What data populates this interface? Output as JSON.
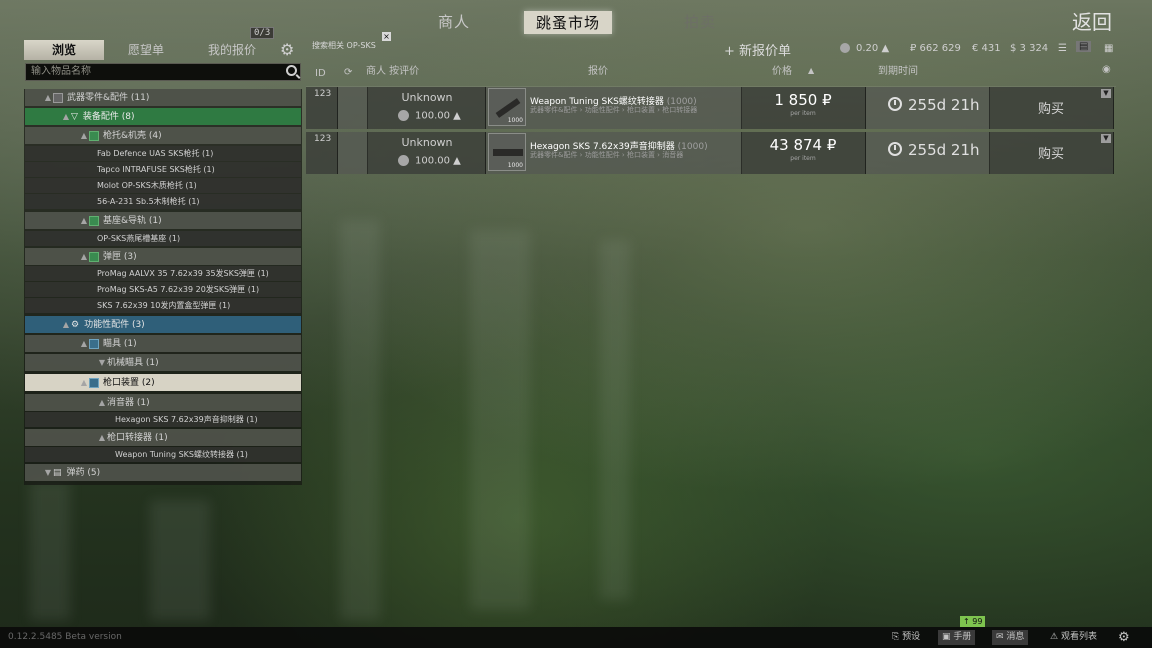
{
  "nav": {
    "traders": "商人",
    "flea_market": "跳蚤市场",
    "auction": "拍卖",
    "back": "返回"
  },
  "left_tabs": {
    "browse": "浏览",
    "wishlist": "愿望单",
    "my_offers": "我的报价",
    "offer_count": "0/3"
  },
  "search": {
    "placeholder": "输入物品名称"
  },
  "tree": [
    {
      "label": "武器零件&配件 (11)"
    },
    {
      "label": "装备配件 (8)"
    },
    {
      "label": "枪托&机壳 (4)"
    },
    {
      "label": "Fab Defence UAS SKS枪托 (1)"
    },
    {
      "label": "Tapco INTRAFUSE SKS枪托 (1)"
    },
    {
      "label": "Molot OP-SKS木质枪托 (1)"
    },
    {
      "label": "56-A-231 Sb.5木制枪托 (1)"
    },
    {
      "label": "基座&导轨 (1)"
    },
    {
      "label": "OP-SKS燕尾槽基座 (1)"
    },
    {
      "label": "弹匣 (3)"
    },
    {
      "label": "ProMag AALVX 35 7.62x39 35发SKS弹匣 (1)"
    },
    {
      "label": "ProMag SKS-A5 7.62x39 20发SKS弹匣 (1)"
    },
    {
      "label": "SKS 7.62x39 10发内置盒型弹匣 (1)"
    },
    {
      "label": "功能性配件 (3)"
    },
    {
      "label": "瞄具 (1)"
    },
    {
      "label": "机械瞄具 (1)"
    },
    {
      "label": "枪口装置 (2)"
    },
    {
      "label": "消音器 (1)"
    },
    {
      "label": "Hexagon SKS 7.62x39声音抑制器 (1)"
    },
    {
      "label": "枪口转接器 (1)"
    },
    {
      "label": "Weapon Tuning SKS螺纹转接器 (1)"
    },
    {
      "label": "弹药 (5)"
    }
  ],
  "filter": {
    "tag": "搜索相关 OP-SKS",
    "close": "×"
  },
  "toolbar": {
    "new_offer": "+ 新报价单",
    "rating": "0.20",
    "roubles": "₽ 662 629",
    "euros": "€ 431",
    "dollars": "$ 3 324"
  },
  "headers": {
    "id": "ID",
    "trader": "商人 按评价",
    "offer": "报价",
    "price": "价格",
    "expire": "到期时间"
  },
  "offers": [
    {
      "id": "123",
      "trader": "Unknown",
      "rating": "100.00 ▲",
      "name": "Weapon Tuning SKS螺纹转接器",
      "qty": "(1000)",
      "path": "武器零件&配件 › 功能性配件 › 枪口装置 › 枪口转接器",
      "count": "1000",
      "price": "1 850 ₽",
      "per": "per item",
      "expire": "255d 21h",
      "buy": "购买"
    },
    {
      "id": "123",
      "trader": "Unknown",
      "rating": "100.00 ▲",
      "name": "Hexagon SKS 7.62x39声音抑制器",
      "qty": "(1000)",
      "path": "武器零件&配件 › 功能性配件 › 枪口装置 › 消音器",
      "count": "1000",
      "price": "43 874 ₽",
      "per": "per item",
      "expire": "255d 21h",
      "buy": "购买"
    }
  ],
  "bottom": {
    "version": "0.12.2.5485 Beta version",
    "presets": "预设",
    "handbook": "手册",
    "messages": "消息",
    "watchlist": "观看列表",
    "badge": "99"
  }
}
